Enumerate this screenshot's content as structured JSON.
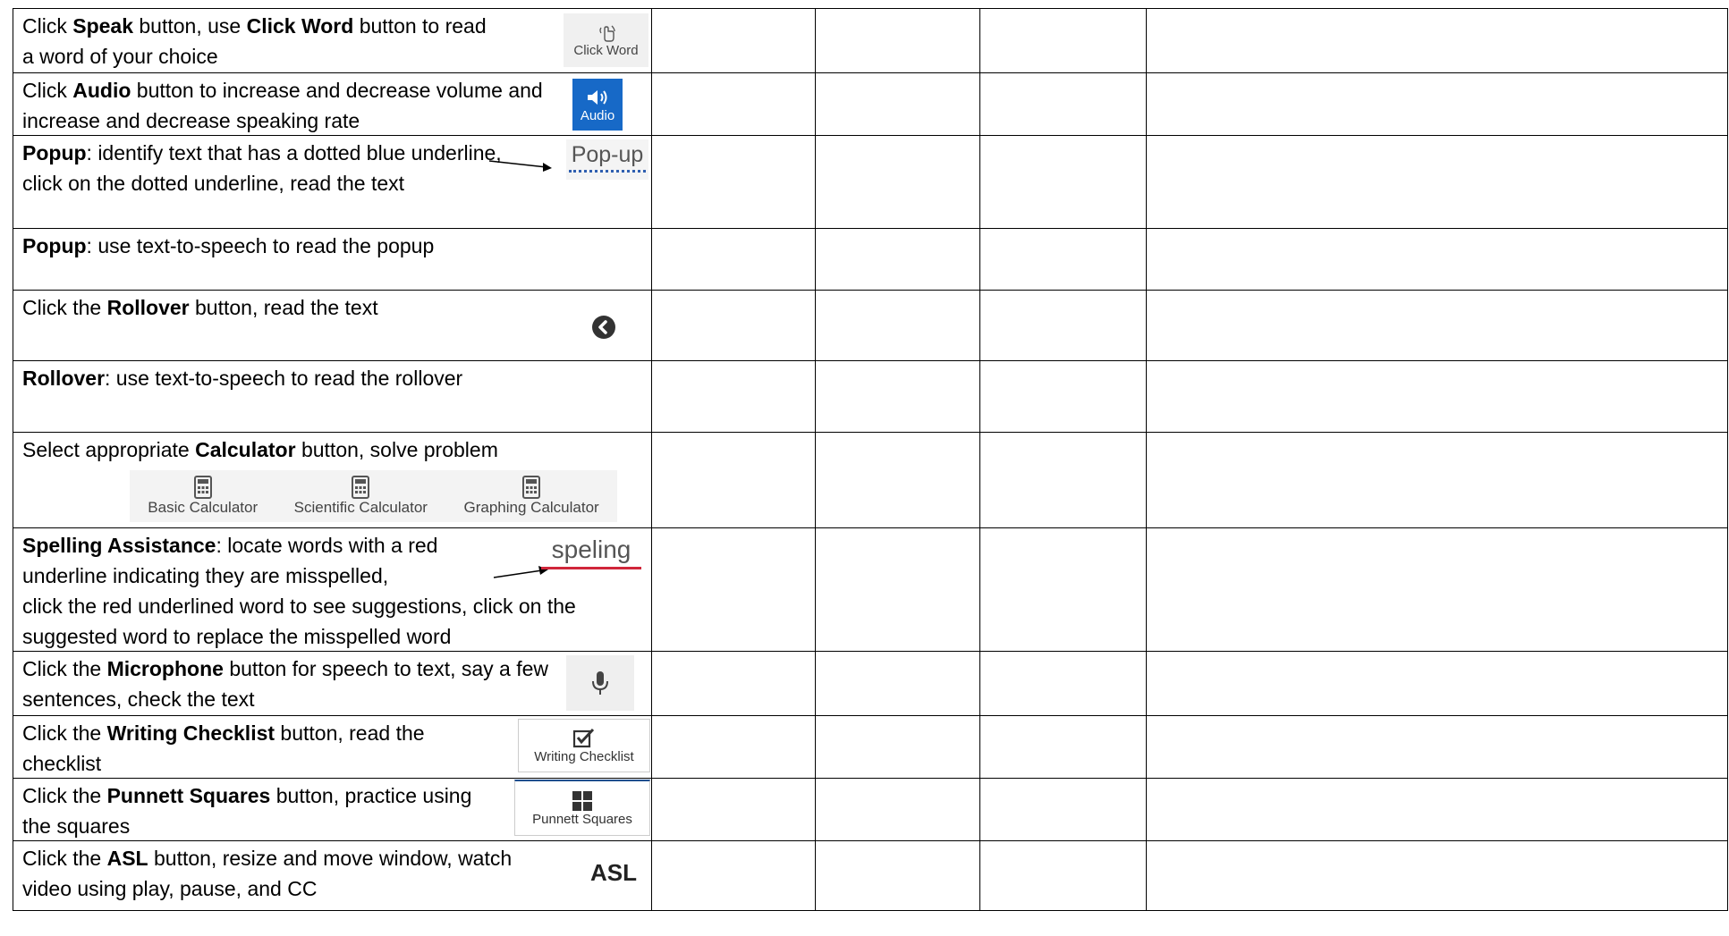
{
  "rows": [
    {
      "pre": "Click ",
      "b1": "Speak",
      "mid": " button, use ",
      "b2": "Click Word",
      "post": " button to read a word of your choice",
      "icon_label": "Click Word"
    },
    {
      "pre": "Click ",
      "b1": "Audio",
      "post": " button to increase and decrease volume and increase and decrease speaking rate",
      "icon_label": "Audio"
    },
    {
      "b1": "Popup",
      "post": ": identify text that has a dotted blue underline, click on the dotted underline, read the text",
      "icon_label": "Pop-up"
    },
    {
      "b1": "Popup",
      "post": ": use text-to-speech to read the popup"
    },
    {
      "pre": "Click the ",
      "b1": "Rollover",
      "post": " button, read the text"
    },
    {
      "b1": "Rollover",
      "post": ": use text-to-speech to read the rollover"
    },
    {
      "pre": "Select appropriate ",
      "b1": "Calculator",
      "post": " button, solve problem",
      "calc_labels": [
        "Basic Calculator",
        "Scientific Calculator",
        "Graphing Calculator"
      ]
    },
    {
      "b1": "Spelling Assistance",
      "post1": ": locate words with a red underline indicating they are misspelled,",
      "post2": "click the red underlined word to see suggestions, click on the suggested word to replace the misspelled word",
      "icon_label": "speling"
    },
    {
      "pre": "Click the ",
      "b1": "Microphone",
      "post": " button for speech to text, say a few sentences, check the text"
    },
    {
      "pre": "Click the ",
      "b1": "Writing Checklist",
      "post": " button, read the checklist",
      "icon_label": "Writing Checklist"
    },
    {
      "pre": "Click the ",
      "b1": "Punnett Squares",
      "post": " button, practice using the squares",
      "icon_label": "Punnett Squares"
    },
    {
      "pre": "Click the ",
      "b1": "ASL",
      "post": " button, resize and move window, watch video using play, pause, and CC",
      "icon_label": "ASL"
    }
  ],
  "colors": {
    "audio_bg": "#1769c7",
    "popup_underline": "#2f5fb0",
    "spelling_underline": "#d0263a"
  }
}
